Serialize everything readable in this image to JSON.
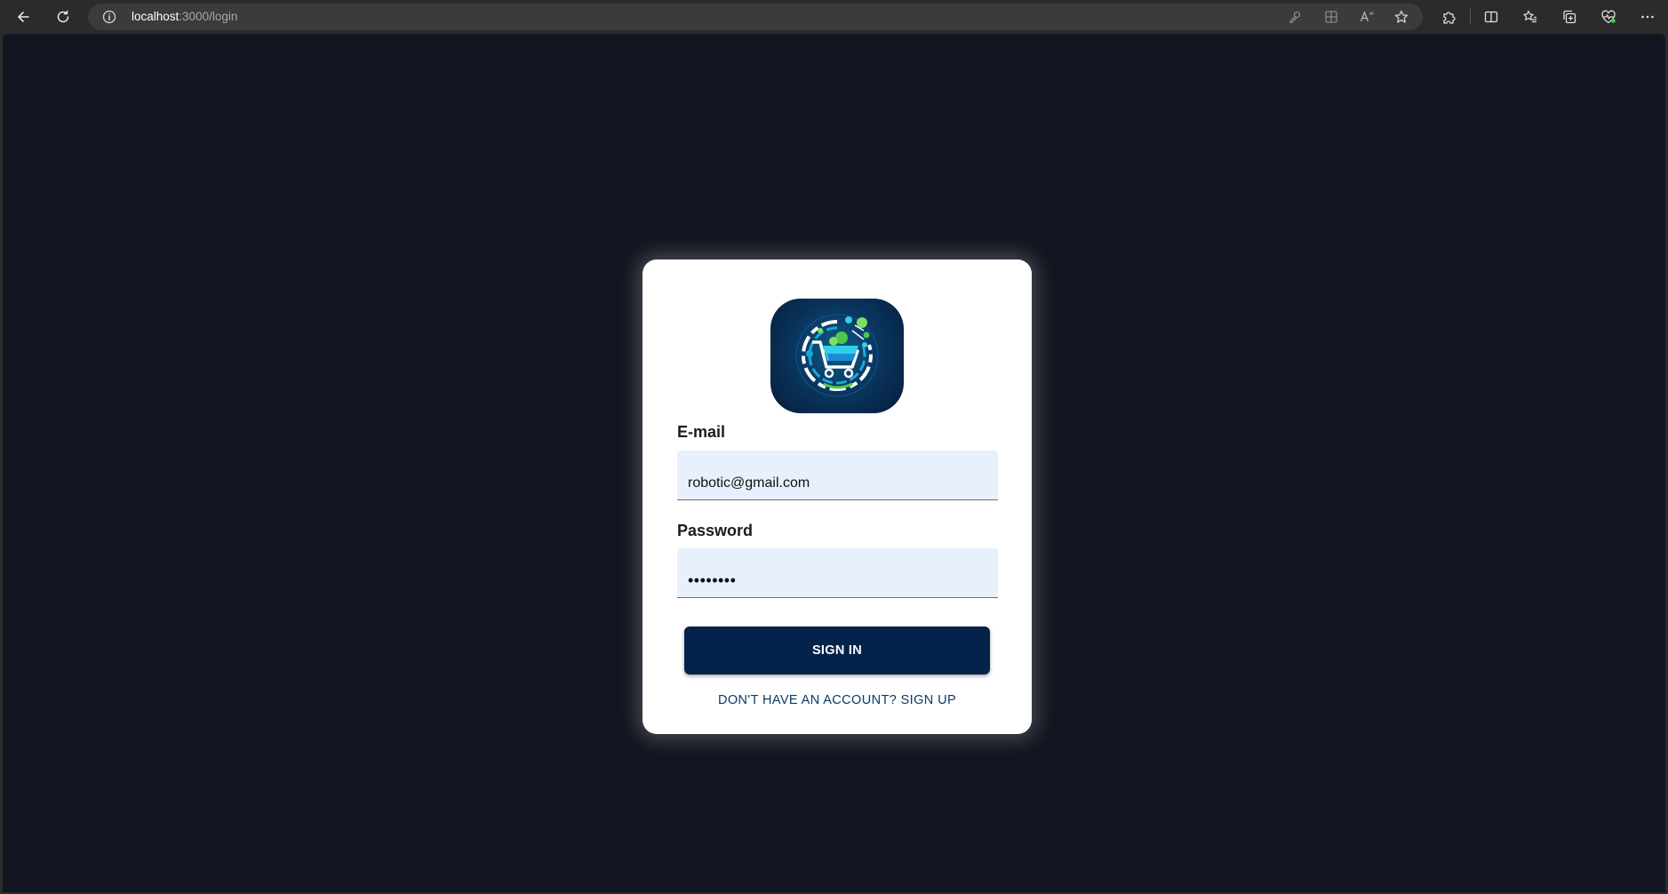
{
  "browser": {
    "url_host": "localhost",
    "url_path": ":3000/login",
    "icons": {
      "back": "back-arrow-icon",
      "refresh": "refresh-icon",
      "site_info": "info-icon",
      "key": "key-icon",
      "app_available": "app-available-icon",
      "read_aloud": "read-aloud-icon",
      "favorite": "star-icon",
      "extensions": "puzzle-icon",
      "split_screen": "split-screen-icon",
      "favorites": "favorites-icon",
      "collections": "collections-icon",
      "health": "health-icon",
      "more": "more-icon"
    }
  },
  "login": {
    "logo": "shopping-cart-logo",
    "email_label": "E-mail",
    "email_value": "robotic@gmail.com",
    "password_label": "Password",
    "password_value": "password",
    "signin_label": "SIGN IN",
    "signup_link": "DON'T HAVE AN ACCOUNT? SIGN UP"
  },
  "colors": {
    "page_background": "#121620",
    "card_background": "#ffffff",
    "input_background": "#e8f0fe",
    "button_background": "#05224a",
    "link_color": "#0a3a66"
  }
}
